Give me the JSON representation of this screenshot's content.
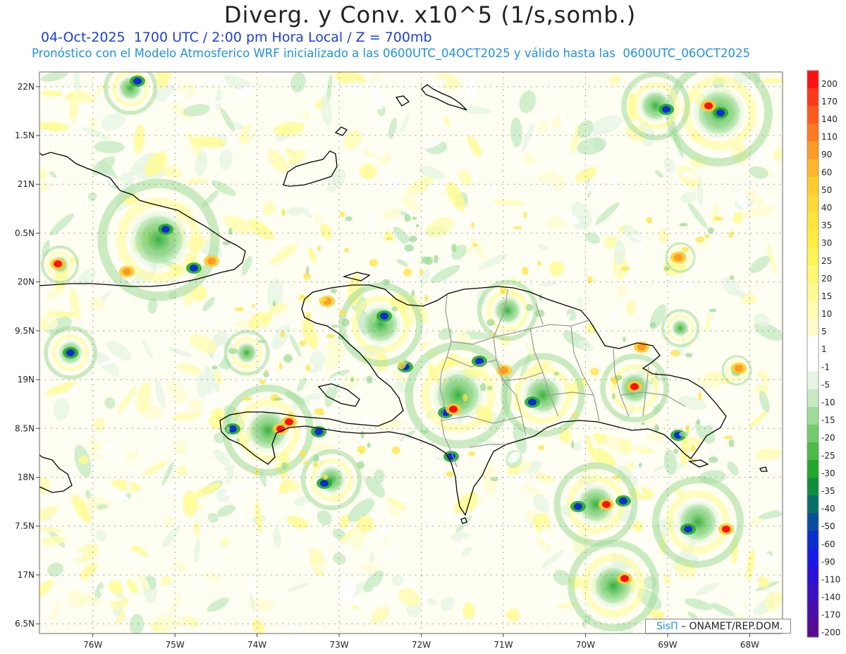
{
  "header": {
    "title": "Diverg. y Conv. x10^5 (1/s,somb.)",
    "line1": "04-Oct-2025  1700 UTC / 2:00 pm Hora Local / Z = 700mb",
    "line2": "Pronóstico con el Modelo Atmosferico WRF inicializado a las 0600UTC_04OCT2025 y válido hasta las  0600UTC_06OCT2025"
  },
  "map": {
    "lat_labels": [
      "22N",
      "1.5N",
      "21N",
      "0.5N",
      "20N",
      "9.5N",
      "19N",
      "8.5N",
      "18N",
      "7.5N",
      "17N",
      "6.5N"
    ],
    "lat_values": [
      22,
      21.5,
      21,
      20.5,
      20,
      19.5,
      19,
      18.5,
      18,
      17.5,
      17,
      16.5
    ],
    "lon_labels": [
      "76W",
      "75W",
      "74W",
      "73W",
      "72W",
      "71W",
      "70W",
      "69W",
      "68W"
    ],
    "lon_values": [
      -76,
      -75,
      -74,
      -73,
      -72,
      -71,
      -70,
      -69,
      -68
    ],
    "lat_range": [
      16.4,
      22.15
    ],
    "lon_range": [
      -76.65,
      -67.6
    ],
    "grid": "dotted",
    "colors": {
      "background": "#ffffff",
      "coastline": "#000000",
      "borders": "#999999",
      "grid": "#777777"
    }
  },
  "colorbar": {
    "labels": [
      "200",
      "170",
      "140",
      "110",
      "90",
      "60",
      "50",
      "40",
      "35",
      "30",
      "25",
      "20",
      "15",
      "10",
      "5",
      "1",
      "-1",
      "-5",
      "-10",
      "-15",
      "-20",
      "-25",
      "-30",
      "-35",
      "-40",
      "-50",
      "-60",
      "-90",
      "-110",
      "-140",
      "-170",
      "-200"
    ],
    "colors": [
      "#ff1010",
      "#ff3a1a",
      "#ff5a1e",
      "#ff7a22",
      "#ff9a26",
      "#ffb52a",
      "#ffcc2c",
      "#ffd83a",
      "#ffe43c",
      "#ffee40",
      "#fff455",
      "#fff872",
      "#fffb90",
      "#fffcb0",
      "#fffdd0",
      "#ffffff",
      "#ffffff",
      "#e6f5e3",
      "#c6ebc3",
      "#9edb98",
      "#72cb6c",
      "#4cbb47",
      "#22a82a",
      "#0f8e3c",
      "#0a6f6a",
      "#0a4ea0",
      "#0a2ed0",
      "#1a1ae8",
      "#2a10d8",
      "#3a10c0",
      "#4810a8",
      "#580a90"
    ]
  },
  "credit": {
    "logo": "SisΠ",
    "text": "– ONAMET/REP.DOM."
  }
}
